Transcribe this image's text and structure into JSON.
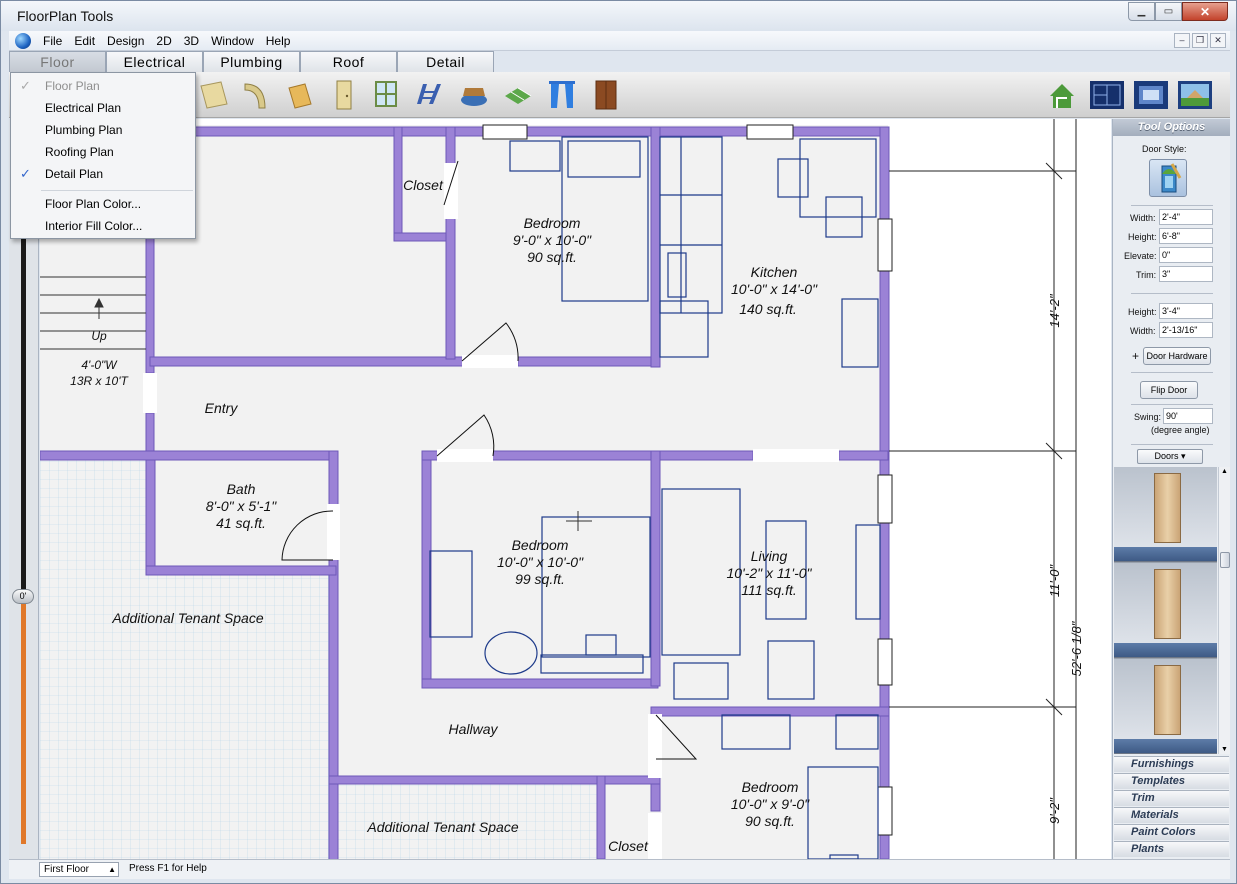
{
  "window": {
    "title": "FloorPlan Tools"
  },
  "menubar": {
    "items": [
      "File",
      "Edit",
      "Design",
      "2D",
      "3D",
      "Window",
      "Help"
    ]
  },
  "tabs": [
    "Floor",
    "Electrical",
    "Plumbing",
    "Roof",
    "Detail"
  ],
  "floor_menu": {
    "items": [
      {
        "label": "Floor Plan",
        "checked": true,
        "disabled": true
      },
      {
        "label": "Electrical Plan",
        "checked": false
      },
      {
        "label": "Plumbing Plan",
        "checked": false
      },
      {
        "label": "Roofing Plan",
        "checked": false
      },
      {
        "label": "Detail Plan",
        "checked": true
      }
    ],
    "extra": [
      "Floor Plan Color...",
      "Interior Fill Color..."
    ]
  },
  "slider": {
    "value_label": "0'"
  },
  "plan": {
    "rooms": [
      {
        "name": "Closet",
        "dims": "",
        "area": ""
      },
      {
        "name": "Bedroom",
        "dims": "9'-0\" x 10'-0\"",
        "area": "90 sq.ft."
      },
      {
        "name": "Kitchen",
        "dims": "10'-0\" x 14'-0\"",
        "area": "140 sq.ft."
      },
      {
        "name": "Entry",
        "dims": "",
        "area": ""
      },
      {
        "name": "Bath",
        "dims": "8'-0\" x 5'-1\"",
        "area": "41 sq.ft."
      },
      {
        "name": "Bedroom",
        "dims": "10'-0\" x 10'-0\"",
        "area": "99 sq.ft."
      },
      {
        "name": "Living",
        "dims": "10'-2\" x 11'-0\"",
        "area": "111 sq.ft."
      },
      {
        "name": "Additional Tenant Space",
        "dims": "",
        "area": ""
      },
      {
        "name": "Hallway",
        "dims": "",
        "area": ""
      },
      {
        "name": "Additional Tenant Space",
        "dims": "",
        "area": ""
      },
      {
        "name": "Bedroom",
        "dims": "10'-0\" x 9'-0\"",
        "area": "90 sq.ft."
      },
      {
        "name": "Closet",
        "dims": "",
        "area": ""
      }
    ],
    "stairs": {
      "label": "Up",
      "width": "4'-0\"W",
      "rise": "13R x 10'T"
    },
    "dimensions": [
      "14'-2\"",
      "11'-0\"",
      "9'-2\"",
      "52'-6 1/8\""
    ]
  },
  "tool_options": {
    "header": "Tool Options",
    "door_style_label": "Door Style:",
    "fields": [
      {
        "label": "Width:",
        "value": "2'-4\""
      },
      {
        "label": "Height:",
        "value": "6'-8\""
      },
      {
        "label": "Elevate:",
        "value": "0\""
      },
      {
        "label": "Trim:",
        "value": "3\""
      }
    ],
    "fields2": [
      {
        "label": "Height:",
        "value": "3'-4\""
      },
      {
        "label": "Width:",
        "value": "2'-13/16\""
      }
    ],
    "plus": "+",
    "door_hardware": "Door Hardware",
    "flip_door": "Flip Door",
    "swing_label": "Swing:",
    "swing_value": "90'",
    "degree_note": "(degree angle)",
    "doors_dropdown": "Doors"
  },
  "accordion": [
    "Furnishings",
    "Templates",
    "Trim",
    "Materials",
    "Paint Colors",
    "Plants"
  ],
  "status": {
    "floor": "First Floor",
    "help": "Press F1 for Help"
  },
  "colors": {
    "wall": "#9b82d6",
    "wall_dark": "#6e58b8",
    "furniture": "#1d3a8a",
    "canvas_floor": "#f2f2f2"
  }
}
